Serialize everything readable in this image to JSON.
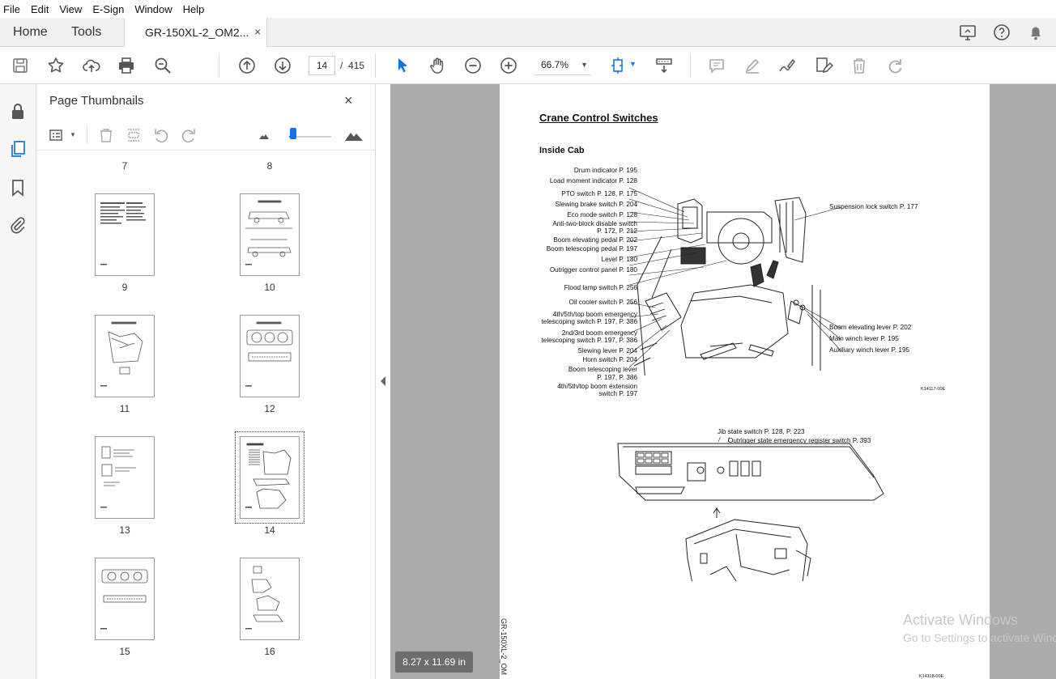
{
  "menu": [
    "File",
    "Edit",
    "View",
    "E-Sign",
    "Window",
    "Help"
  ],
  "tabs": {
    "home": "Home",
    "tools": "Tools",
    "document": "GR-150XL-2_OM2...",
    "close": "×"
  },
  "toolbar": {
    "current_page": "14",
    "page_separator": "/",
    "total_pages": "415",
    "zoom": "66.7%"
  },
  "thumbnails_panel": {
    "title": "Page Thumbnails",
    "close": "×",
    "top_labels": [
      "7",
      "8"
    ],
    "pages": [
      {
        "label": "9"
      },
      {
        "label": "10"
      },
      {
        "label": "11"
      },
      {
        "label": "12"
      },
      {
        "label": "13"
      },
      {
        "label": "14",
        "selected": true
      },
      {
        "label": "15"
      },
      {
        "label": "16"
      }
    ],
    "thumbnail_size_level": 0.1
  },
  "document": {
    "title": "Crane Control Switches",
    "subtitle": "Inside Cab",
    "left_labels": [
      "Drum indicator P. 195",
      "Load moment indicator P. 128",
      "PTO switch P. 128, P. 175",
      "Slewing brake switch P. 204",
      "Eco mode switch P. 128",
      "Anti-two-block disable switch",
      "P. 172, P. 212",
      "Boom elevating pedal P. 202",
      "Boom telescoping pedal P. 197",
      "Level P. 180",
      "Outrigger control panel P. 180",
      "Flood lamp switch P. 256",
      "Oil cooler switch P. 256",
      "4th/5th/top boom emergency",
      "telescoping switch P. 197, P. 386",
      "2nd/3rd boom emergency",
      "telescoping switch P. 197, P. 386",
      "Slewing lever P. 204",
      "Horn switch P. 204",
      "Boom telescoping lever",
      "P. 197, P. 386",
      "4th/5th/top boom extension",
      "switch P. 197"
    ],
    "right_labels": [
      "Suspension lock switch P. 177",
      "Boom elevating lever P. 202",
      "Main winch lever P. 195",
      "Auxiliary winch lever P. 195"
    ],
    "figure1_code": "K14117-00E",
    "figure2_labels": [
      "Jib state switch P. 128, P. 223",
      "Outrigger state emergency register switch P. 393"
    ],
    "figure2_code": "K14118-00E",
    "side_text": "GR-150XL-2_OM"
  },
  "page_size_badge": "8.27 x 11.69 in",
  "watermark": {
    "line1": "Activate Windows",
    "line2": "Go to Settings to activate Windows."
  },
  "colors": {
    "accent": "#1473e6",
    "doc_background": "#ababab"
  }
}
